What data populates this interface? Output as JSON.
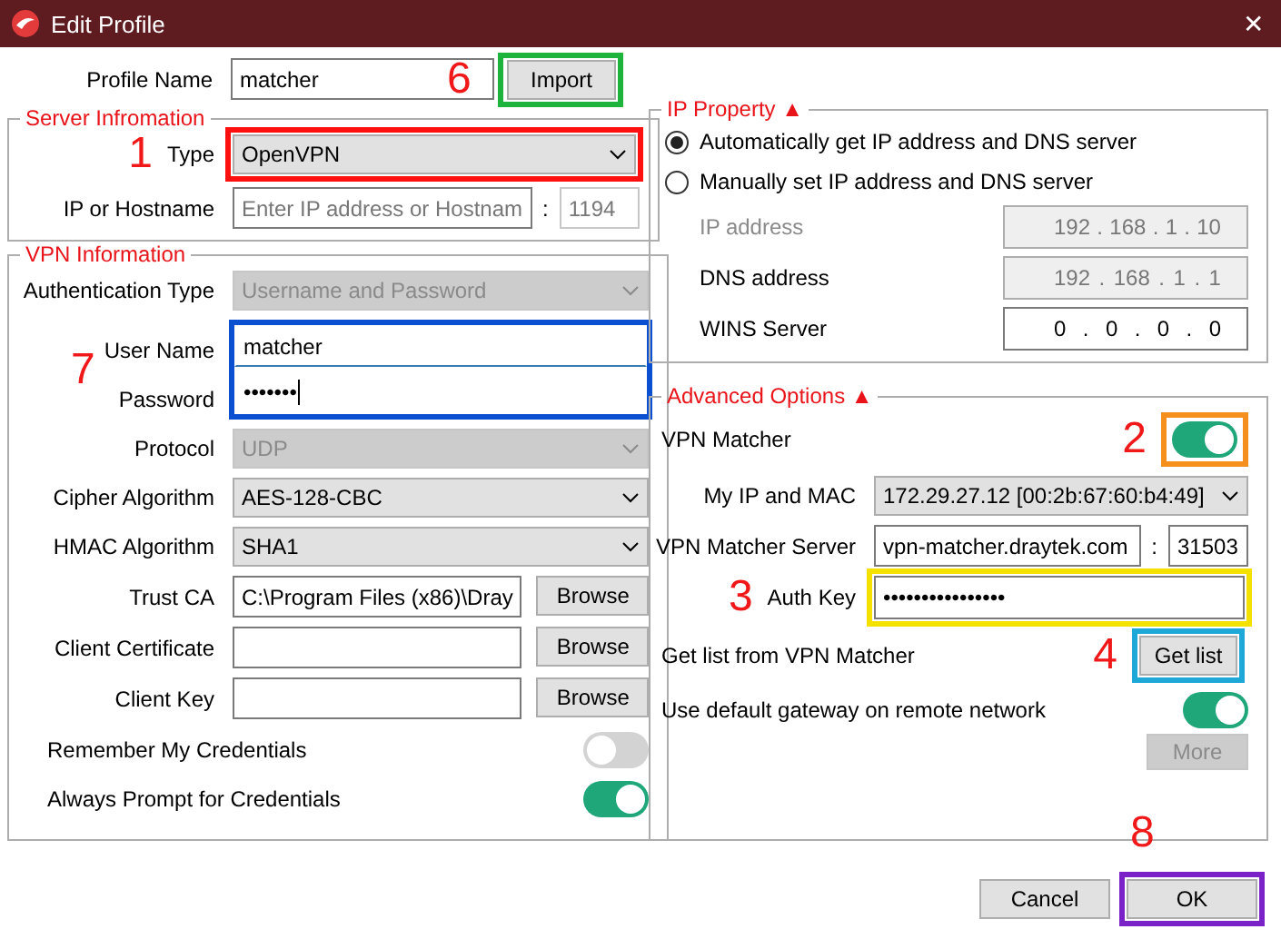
{
  "window": {
    "title": "Edit Profile",
    "close": "✕"
  },
  "profile": {
    "label": "Profile Name",
    "value": "matcher",
    "callout": "6",
    "button": {
      "label": "Import",
      "color": "#1eb33c"
    }
  },
  "server_information": {
    "title": "Server Infromation",
    "rows": [
      {
        "kind": "select",
        "label": "Type",
        "value": "OpenVPN",
        "disabled": false,
        "color": "#ff1010",
        "callout": "1"
      },
      {
        "kind": "host",
        "label": "IP or Hostname",
        "placeholder": "Enter IP address or Hostnam",
        "separator": ":",
        "port": "1194",
        "port_disabled": true
      }
    ]
  },
  "vpn_information": {
    "title": "VPN Information",
    "rows": [
      {
        "kind": "select",
        "label": "Authentication Type",
        "value": "Username and Password",
        "disabled": true
      },
      {
        "kind": "pair",
        "color": "#0a50d0",
        "callout": "7",
        "rows": [
          {
            "kind": "text",
            "label": "User Name",
            "value": "matcher",
            "cursor": false
          },
          {
            "kind": "text",
            "label": "Password",
            "value": "•••••••",
            "cursor": true
          }
        ]
      },
      {
        "kind": "select",
        "label": "Protocol",
        "value": "UDP",
        "disabled": true
      },
      {
        "kind": "select",
        "label": "Cipher Algorithm",
        "value": "AES-128-CBC",
        "disabled": false
      },
      {
        "kind": "select",
        "label": "HMAC Algorithm",
        "value": "SHA1",
        "disabled": false
      },
      {
        "kind": "file",
        "label": "Trust CA",
        "value": "C:\\Program Files (x86)\\Dray",
        "button": "Browse"
      },
      {
        "kind": "file",
        "label": "Client Certificate",
        "button": "Browse"
      },
      {
        "kind": "file",
        "label": "Client Key",
        "button": "Browse"
      },
      {
        "kind": "toggle",
        "label": "Remember My Credentials",
        "on": false
      },
      {
        "kind": "toggle",
        "label": "Always Prompt for Credentials",
        "on": true
      }
    ]
  },
  "ip_property": {
    "title": "IP Property ▲",
    "rows": [
      {
        "kind": "radio",
        "label": "Automatically get IP address and DNS server",
        "selected": true
      },
      {
        "kind": "radio",
        "label": "Manually set IP address and DNS server",
        "selected": false
      },
      {
        "kind": "ip",
        "label": "IP address",
        "label_disabled": true,
        "disabled": true,
        "value": "192 . 168 . 1 . 10"
      },
      {
        "kind": "ip",
        "label": "DNS address",
        "label_disabled": false,
        "disabled": true,
        "value": "192 . 168 . 1 . 1"
      },
      {
        "kind": "ip",
        "label": "WINS Server",
        "label_disabled": false,
        "disabled": false,
        "value": "0 . 0 . 0 . 0"
      }
    ]
  },
  "advanced_options": {
    "title": "Advanced Options ▲",
    "rows": [
      {
        "kind": "toggle",
        "label": "VPN Matcher",
        "on": true,
        "color": "#f5901e",
        "callout": "2"
      },
      {
        "kind": "select",
        "label": "My IP and MAC",
        "value": "172.29.27.12 [00:2b:67:60:b4:49]",
        "disabled": false
      },
      {
        "kind": "host",
        "label": "VPN Matcher Server",
        "value": "vpn-matcher.draytek.com",
        "separator": ":",
        "port": "31503",
        "port_disabled": false
      },
      {
        "kind": "text",
        "label": "Auth Key",
        "value": "••••••••••••••••",
        "color": "#f5e100",
        "callout": "3"
      },
      {
        "kind": "button-row",
        "label": "Get list from VPN Matcher",
        "button": "Get list",
        "color": "#1ea8d8",
        "callout": "4"
      },
      {
        "kind": "toggle",
        "label": "Use default gateway on remote network",
        "on": true
      },
      {
        "kind": "button",
        "label": "More",
        "disabled": true
      }
    ]
  },
  "footer": {
    "buttons": [
      {
        "label": "Cancel"
      },
      {
        "label": "OK",
        "color": "#7a22c8",
        "callout": "8"
      }
    ]
  }
}
